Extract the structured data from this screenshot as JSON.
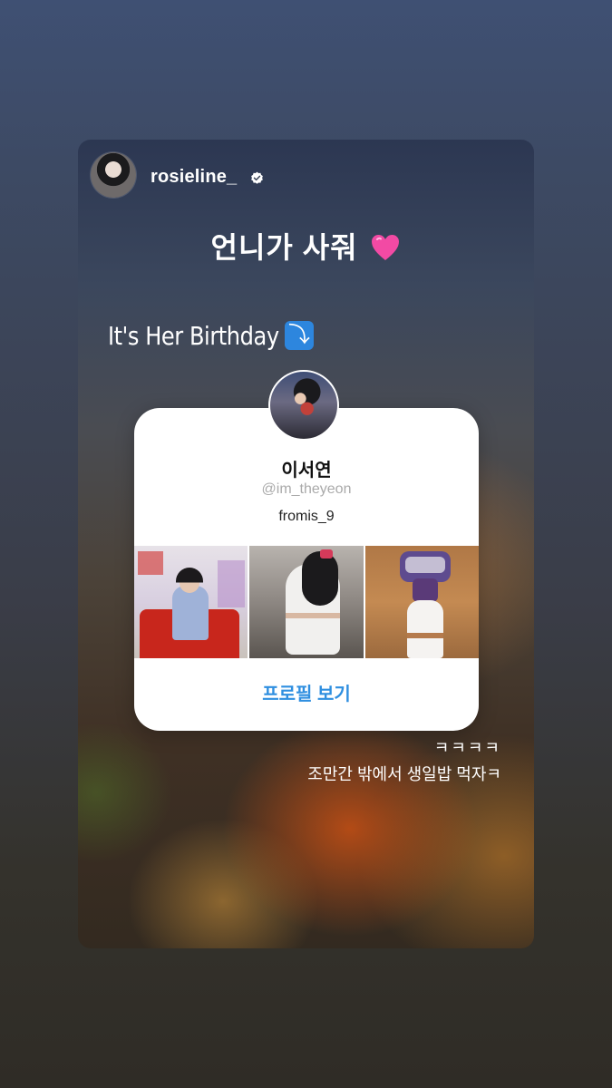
{
  "story": {
    "username": "rosieline_",
    "headline": "언니가 사줘",
    "headline_emoji": "pink-heart-icon",
    "birthday_text": "It's Her Birthday",
    "birthday_arrow": "⤵"
  },
  "profile_card": {
    "name": "이서연",
    "handle": "@im_theyeon",
    "bio": "fromis_9",
    "button_label": "프로필 보기"
  },
  "captions": [
    "ㅋㅋㅋㅋ",
    "조만간 밖에서 생일밥 먹자ㅋ"
  ],
  "colors": {
    "button_text": "#2f8fe0",
    "arrow_sticker": "#2d86de",
    "heart": "#f24aa4"
  }
}
